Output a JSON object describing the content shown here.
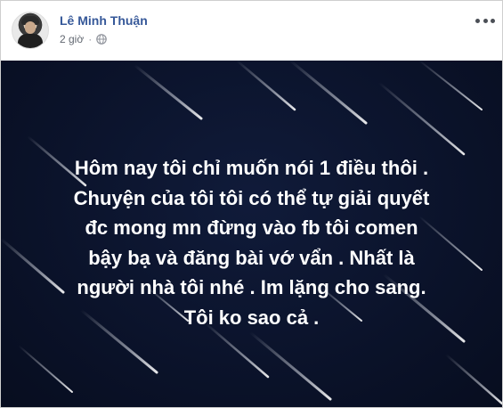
{
  "post": {
    "author": "Lê Minh Thuận",
    "time": "2 giờ",
    "separator": "·",
    "privacy_icon": "globe-icon",
    "more_icon": "ellipsis-icon",
    "text_lines": [
      "Hôm nay tôi chỉ muốn nói 1 điều thôi .",
      "Chuyện của tôi tôi có thể tự giải quyết",
      "đc mong mn đừng vào fb tôi comen",
      "bậy bạ và đăng bài vớ vẩn . Nhất là",
      "người nhà tôi nhé . Im lặng cho sang.",
      "Tôi ko sao cả ."
    ]
  },
  "colors": {
    "author": "#365899",
    "meta": "#616770",
    "background_dark": "#0b132b",
    "text": "#ffffff"
  }
}
